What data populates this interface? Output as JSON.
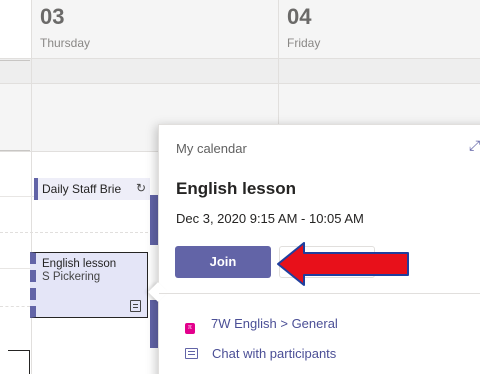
{
  "calendar": {
    "days": [
      {
        "number": "03",
        "name": "Thursday"
      },
      {
        "number": "04",
        "name": "Friday"
      }
    ]
  },
  "events": {
    "staff_brief": {
      "title": "Daily Staff Brie",
      "icon": "sync-icon"
    },
    "english_lesson": {
      "title": "English lesson",
      "organizer": "S Pickering",
      "icon": "notes-icon"
    }
  },
  "popup": {
    "source": "My calendar",
    "expand_icon": "expand-icon",
    "title": "English lesson",
    "time": "Dec 3, 2020 9:15 AM - 10:05 AM",
    "join_label": "Join",
    "channel": {
      "icon": "channel-icon",
      "text": "7W English > General",
      "color": "#e3008c"
    },
    "chat": {
      "icon": "chat-icon",
      "text": "Chat with participants"
    }
  },
  "colors": {
    "accent": "#6264a7",
    "annotation_arrow": "#e8101a"
  }
}
